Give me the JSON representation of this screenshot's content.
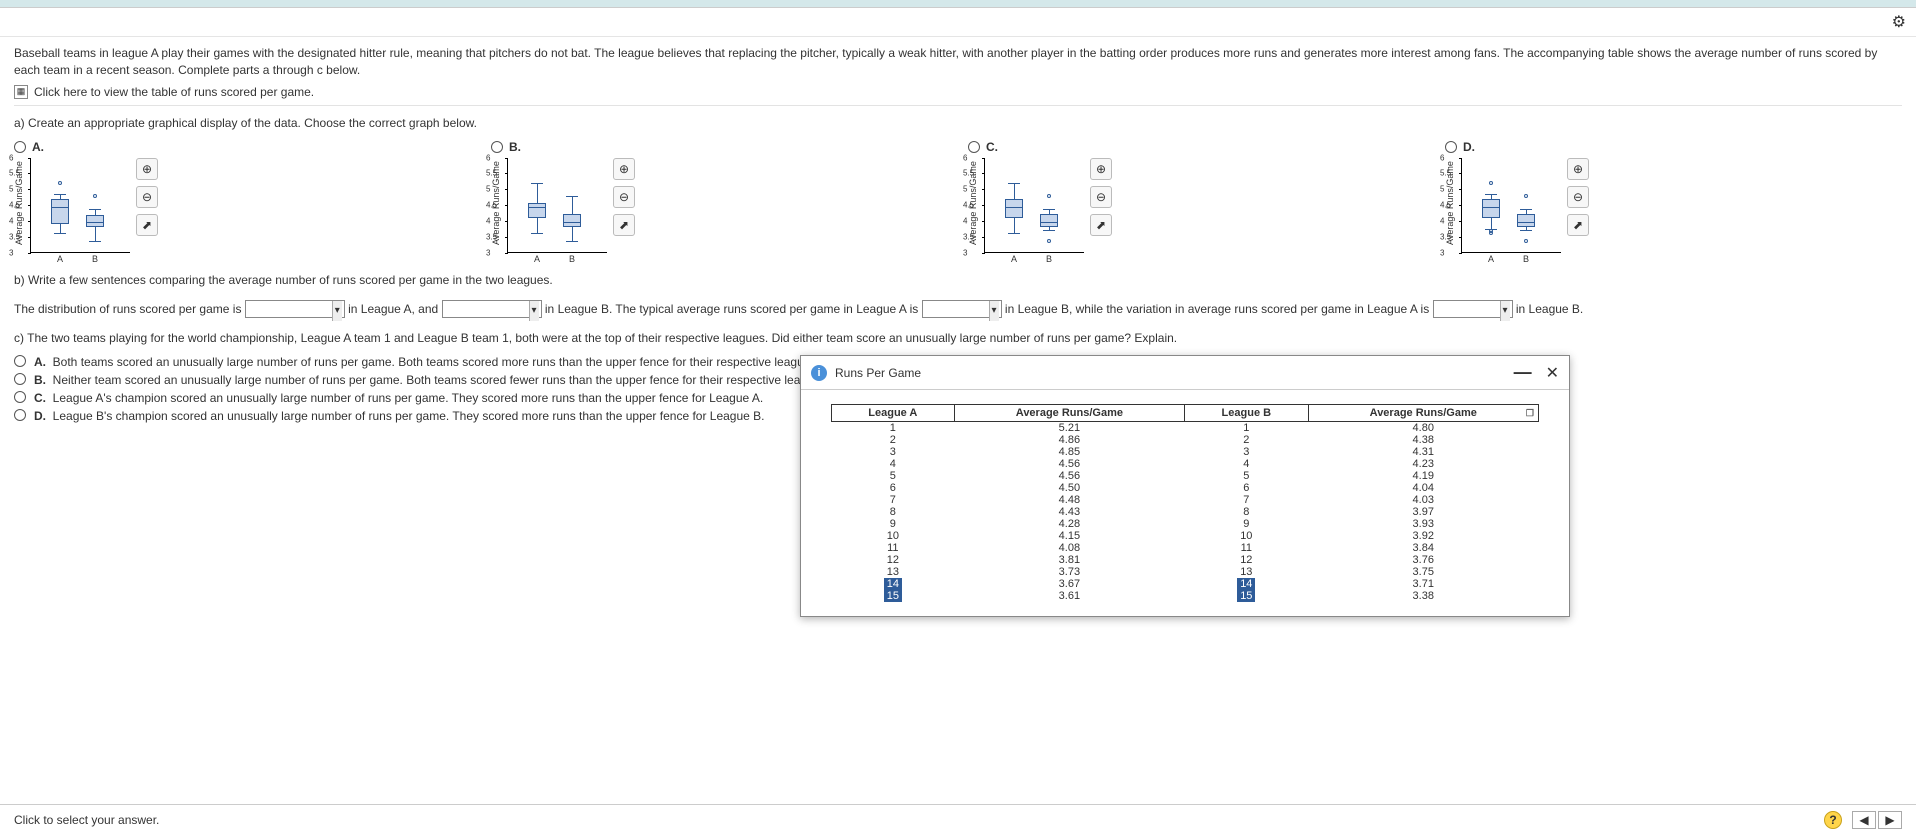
{
  "intro_text": "Baseball teams in league A play their games with the designated hitter rule, meaning that pitchers do not bat. The league believes that replacing the pitcher, typically a weak hitter, with another player in the batting order produces more runs and generates more interest among fans. The accompanying table shows the average number of runs scored by each team in a recent season. Complete parts a through c below.",
  "link_text": "Click here to view the table of runs scored per game.",
  "part_a": "a) Create an appropriate graphical display of the data. Choose the correct graph below.",
  "opts": {
    "A": "A.",
    "B": "B.",
    "C": "C.",
    "D": "D."
  },
  "ylabel": "Average Runs/Game",
  "xcat": {
    "A": "A",
    "B": "B"
  },
  "part_b": "b) Write a few sentences comparing the average number of runs scored per game in the two leagues.",
  "fill": {
    "p1": "The distribution of runs scored per game is ",
    "p2": " in League A, and ",
    "p3": " in League B. The typical average runs scored per game in League A is ",
    "p4": " in League B, while the variation in average runs scored per game in League A is ",
    "p5": " in League B."
  },
  "part_c": "c) The two teams playing for the world championship, League A team 1 and League B team 1, both were at the top of their respective leagues. Did either team score an unusually large number of runs per game? Explain.",
  "mc": {
    "A": "Both teams scored an unusually large number of runs per game. Both teams scored more runs than the upper fence for their respective leagues.",
    "B": "Neither team scored an unusually large number of runs per game. Both teams scored fewer runs than the upper fence for their respective leagues.",
    "C": "League A's champion scored an unusually large number of runs per game. They scored more runs than the upper fence for League A.",
    "D": "League B's champion scored an unusually large number of runs per game. They scored more runs than the upper fence for League B."
  },
  "popup_title": "Runs Per Game",
  "table": {
    "headers": [
      "League A",
      "Average Runs/Game",
      "League B",
      "Average Runs/Game"
    ],
    "rows": [
      [
        "1",
        "5.21",
        "1",
        "4.80"
      ],
      [
        "2",
        "4.86",
        "2",
        "4.38"
      ],
      [
        "3",
        "4.85",
        "3",
        "4.31"
      ],
      [
        "4",
        "4.56",
        "4",
        "4.23"
      ],
      [
        "5",
        "4.56",
        "5",
        "4.19"
      ],
      [
        "6",
        "4.50",
        "6",
        "4.04"
      ],
      [
        "7",
        "4.48",
        "7",
        "4.03"
      ],
      [
        "8",
        "4.43",
        "8",
        "3.97"
      ],
      [
        "9",
        "4.28",
        "9",
        "3.93"
      ],
      [
        "10",
        "4.15",
        "10",
        "3.92"
      ],
      [
        "11",
        "4.08",
        "11",
        "3.84"
      ],
      [
        "12",
        "3.81",
        "12",
        "3.76"
      ],
      [
        "13",
        "3.73",
        "13",
        "3.75"
      ],
      [
        "14",
        "3.67",
        "14",
        "3.71"
      ],
      [
        "15",
        "3.61",
        "15",
        "3.38"
      ]
    ],
    "highlight_rows": [
      13,
      14
    ]
  },
  "footer_text": "Click to select your answer.",
  "chart_data": [
    {
      "type": "boxplot",
      "option": "A",
      "ylim": [
        3,
        6
      ],
      "ticks": [
        3,
        3.5,
        4,
        4.5,
        5,
        5.5,
        6
      ],
      "series": [
        {
          "name": "A",
          "min": 3.61,
          "q1": 3.9,
          "median": 4.43,
          "q3": 4.7,
          "max": 4.86,
          "outliers": [
            5.21
          ]
        },
        {
          "name": "B",
          "min": 3.38,
          "q1": 3.8,
          "median": 3.97,
          "q3": 4.2,
          "max": 4.38,
          "outliers": [
            4.8
          ]
        }
      ]
    },
    {
      "type": "boxplot",
      "option": "B",
      "ylim": [
        3,
        6
      ],
      "ticks": [
        3,
        3.5,
        4,
        4.5,
        5,
        5.5,
        6
      ],
      "series": [
        {
          "name": "A",
          "min": 3.61,
          "q1": 4.08,
          "median": 4.43,
          "q3": 4.56,
          "max": 5.21,
          "outliers": []
        },
        {
          "name": "B",
          "min": 3.38,
          "q1": 3.8,
          "median": 3.97,
          "q3": 4.21,
          "max": 4.8,
          "outliers": []
        }
      ]
    },
    {
      "type": "boxplot",
      "option": "C",
      "ylim": [
        3,
        6
      ],
      "ticks": [
        3,
        3.5,
        4,
        4.5,
        5,
        5.5,
        6
      ],
      "series": [
        {
          "name": "A",
          "min": 3.61,
          "q1": 4.08,
          "median": 4.43,
          "q3": 4.7,
          "max": 5.21,
          "outliers": []
        },
        {
          "name": "B",
          "min": 3.71,
          "q1": 3.8,
          "median": 3.97,
          "q3": 4.21,
          "max": 4.38,
          "outliers": [
            4.8,
            3.38
          ]
        }
      ]
    },
    {
      "type": "boxplot",
      "option": "D",
      "ylim": [
        3,
        6
      ],
      "ticks": [
        3,
        3.5,
        4,
        4.5,
        5,
        5.5,
        6
      ],
      "series": [
        {
          "name": "A",
          "min": 3.73,
          "q1": 4.08,
          "median": 4.43,
          "q3": 4.7,
          "max": 4.86,
          "outliers": [
            5.21,
            3.67,
            3.61
          ]
        },
        {
          "name": "B",
          "min": 3.71,
          "q1": 3.8,
          "median": 3.97,
          "q3": 4.21,
          "max": 4.38,
          "outliers": [
            4.8,
            3.38
          ]
        }
      ]
    }
  ]
}
